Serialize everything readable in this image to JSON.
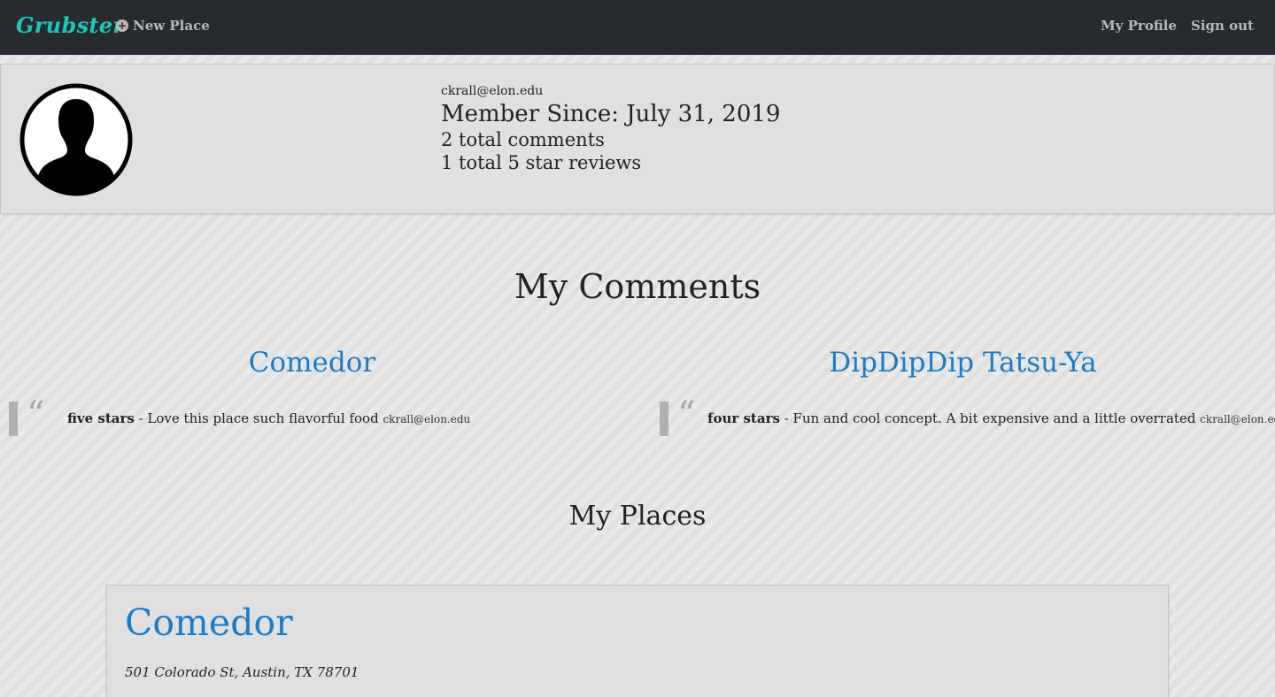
{
  "navbar": {
    "brand": "Grubster",
    "new_place": "New Place",
    "my_profile": "My Profile",
    "sign_out": "Sign out"
  },
  "profile": {
    "email": "ckrall@elon.edu",
    "member_since": "Member Since: July 31, 2019",
    "total_comments": "2 total comments",
    "five_star_reviews": "1 total 5 star reviews"
  },
  "comments_section": {
    "title": "My Comments",
    "items": [
      {
        "place": "Comedor",
        "rating": "five stars",
        "separator": " - ",
        "text": "Love this place such flavorful food",
        "author": "ckrall@elon.edu"
      },
      {
        "place": "DipDipDip Tatsu-Ya",
        "rating": "four stars",
        "separator": " - ",
        "text": "Fun and cool concept. A bit expensive and a little overrated",
        "author": "ckrall@elon.edu"
      }
    ]
  },
  "places_section": {
    "title": "My Places",
    "items": [
      {
        "name": "Comedor",
        "address": "501 Colorado St, Austin, TX 78701"
      }
    ]
  },
  "colors": {
    "navbar_bg": "#272b30",
    "brand": "#1dc7b8",
    "link": "#1c7cc9"
  }
}
